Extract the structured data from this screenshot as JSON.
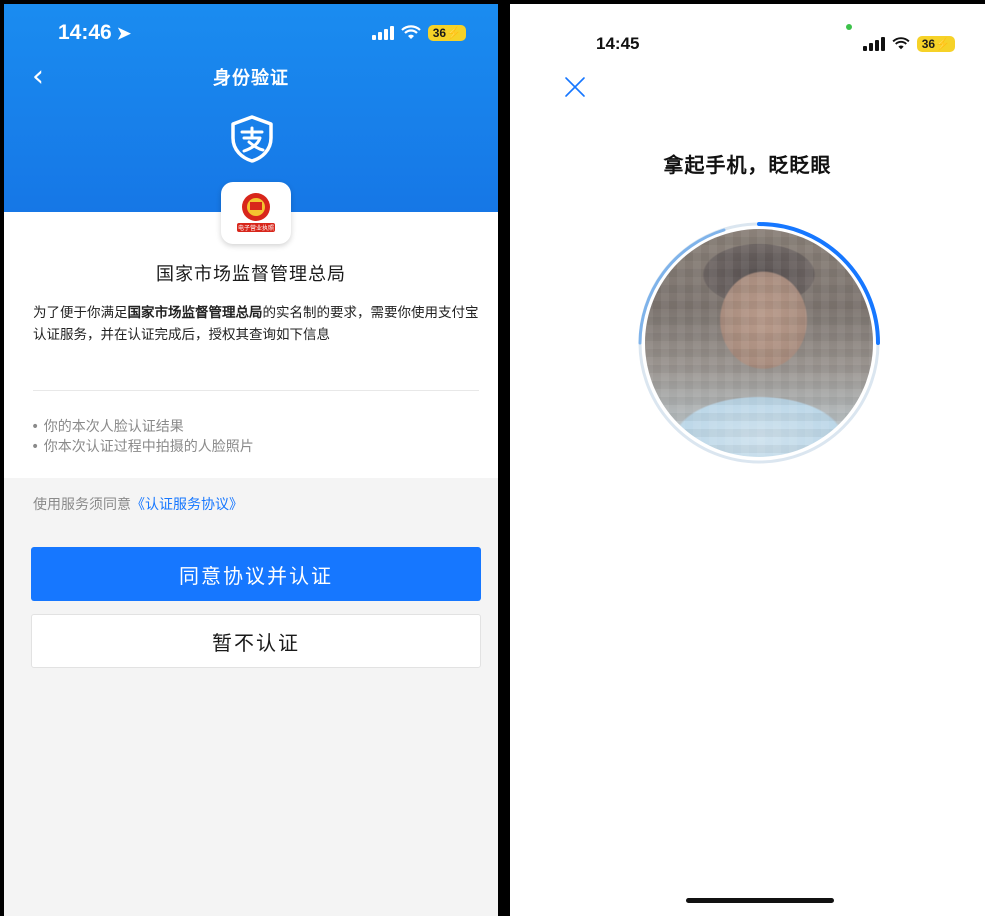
{
  "left_screen": {
    "status_bar": {
      "time": "14:46",
      "battery": "36"
    },
    "nav": {
      "title": "身份验证"
    },
    "app_icon_label": "电子营业执照",
    "org_name": "国家市场监督管理总局",
    "description": {
      "prefix": "为了便于你满足",
      "org_bold": "国家市场监督管理总局",
      "suffix": "的实名制的要求，需要你使用支付宝认证服务，并在认证完成后，授权其查询如下信息"
    },
    "bullets": [
      "你的本次人脸认证结果",
      "你本次认证过程中拍摄的人脸照片"
    ],
    "agreement": {
      "prefix": "使用服务须同意",
      "link": "《认证服务协议》"
    },
    "buttons": {
      "primary": "同意协议并认证",
      "secondary": "暂不认证"
    }
  },
  "right_screen": {
    "status_bar": {
      "time": "14:45",
      "battery": "36"
    },
    "title": "拿起手机，眨眨眼"
  },
  "colors": {
    "alipay_blue": "#1677ff",
    "header_blue": "#1a8cf0",
    "battery_yellow": "#f6d228",
    "emblem_red": "#d8261b"
  }
}
